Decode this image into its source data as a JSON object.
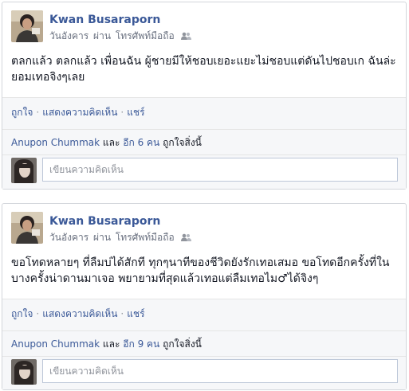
{
  "posts": [
    {
      "author": "Kwan Busaraporn",
      "meta_day": "วันอังคาร",
      "meta_via": "ผ่าน",
      "meta_device": "โทรศัพท์มือถือ",
      "text": "ตลกแล้ว ตลกแล้ว เพื่อนฉัน ผู้ชายมีให้ชอบเยอะแยะไม่ชอบแต่ดันไปชอบเก ฉันล่ะยอมเทอจิงๆเลย",
      "actions": {
        "like": "ถูกใจ",
        "comment": "แสดงความคิดเห็น",
        "share": "แชร์"
      },
      "likes": {
        "name": "Anupon Chummak",
        "and": "และ",
        "others": "อีก 6 คน",
        "suffix": "ถูกใจสิ่งนี้"
      },
      "comment_placeholder": "เขียนความคิดเห็น"
    },
    {
      "author": "Kwan Busaraporn",
      "meta_day": "วันอังคาร",
      "meta_via": "ผ่าน",
      "meta_device": "โทรศัพท์มือถือ",
      "text": "ขอโทดหลายๆ ที่ลืมบ่ได้สักที ทุกๆนาทีของชีวิดยังรักเทอเสมอ ขอโทดอีกครั้งที่ในบางครั้งน่าดานมาเจอ พยายามที่สุดแล้วเทอแต่ลืมเทอไม♂ได้จิงๆ",
      "actions": {
        "like": "ถูกใจ",
        "comment": "แสดงความคิดเห็น",
        "share": "แชร์"
      },
      "likes": {
        "name": "Anupon Chummak",
        "and": "และ",
        "others": "อีก 9 คน",
        "suffix": "ถูกใจสิ่งนี้"
      },
      "comment_placeholder": "เขียนความคิดเห็น"
    }
  ],
  "colors": {
    "link": "#3b5998",
    "meta": "#6a7180",
    "footer_bg": "#f6f7f9",
    "border": "#d3d6db"
  }
}
